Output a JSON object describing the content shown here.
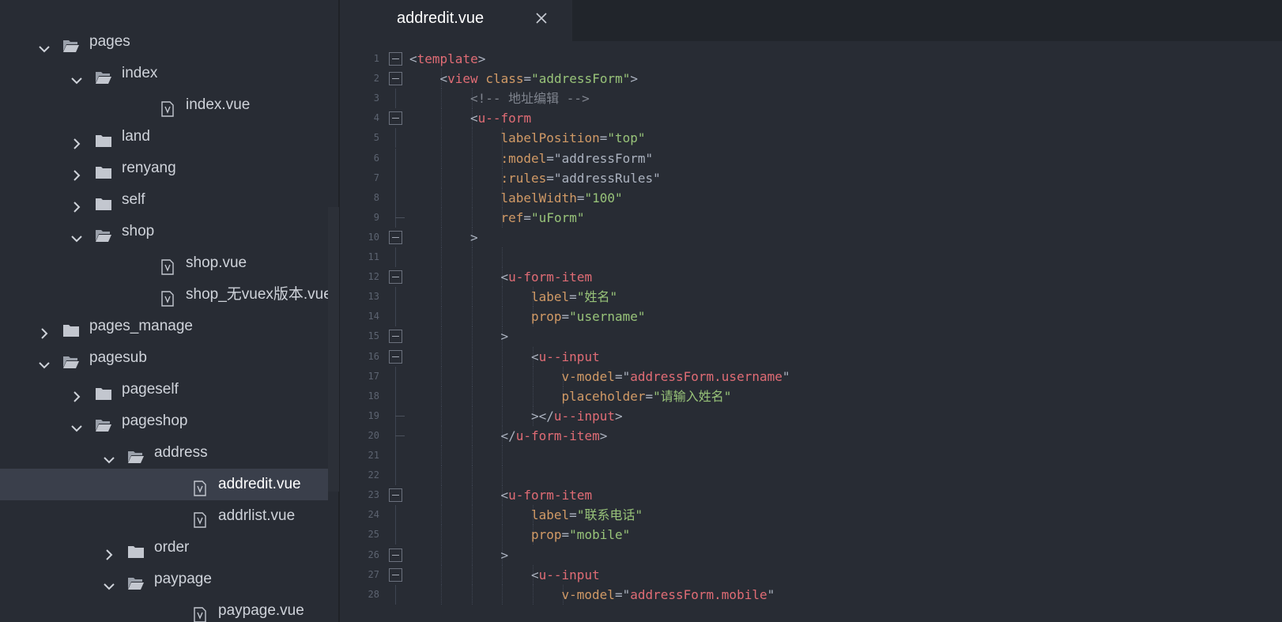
{
  "tab": {
    "label": "addredit.vue",
    "close_icon": "close-icon"
  },
  "tree": [
    {
      "label": "pages",
      "type": "folder",
      "open": true,
      "depth": 1
    },
    {
      "label": "index",
      "type": "folder",
      "open": true,
      "depth": 2
    },
    {
      "label": "index.vue",
      "type": "file",
      "depth": 3
    },
    {
      "label": "land",
      "type": "folder",
      "open": false,
      "depth": 2
    },
    {
      "label": "renyang",
      "type": "folder",
      "open": false,
      "depth": 2
    },
    {
      "label": "self",
      "type": "folder",
      "open": false,
      "depth": 2
    },
    {
      "label": "shop",
      "type": "folder",
      "open": true,
      "depth": 2
    },
    {
      "label": "shop.vue",
      "type": "file",
      "depth": 3
    },
    {
      "label": "shop_无vuex版本.vue",
      "type": "file",
      "depth": 3
    },
    {
      "label": "pages_manage",
      "type": "folder",
      "open": false,
      "depth": 1
    },
    {
      "label": "pagesub",
      "type": "folder",
      "open": true,
      "depth": 1
    },
    {
      "label": "pageself",
      "type": "folder",
      "open": false,
      "depth": 2
    },
    {
      "label": "pageshop",
      "type": "folder",
      "open": true,
      "depth": 2
    },
    {
      "label": "address",
      "type": "folder",
      "open": true,
      "depth": 3
    },
    {
      "label": "addredit.vue",
      "type": "file",
      "depth": 4,
      "selected": true
    },
    {
      "label": "addrlist.vue",
      "type": "file",
      "depth": 4
    },
    {
      "label": "order",
      "type": "folder",
      "open": false,
      "depth": 3
    },
    {
      "label": "paypage",
      "type": "folder",
      "open": true,
      "depth": 3
    },
    {
      "label": "paypage.vue",
      "type": "file",
      "depth": 4
    }
  ],
  "code": [
    {
      "n": "1",
      "indent": 0,
      "fold": "box",
      "tokens": [
        [
          "p",
          "<"
        ],
        [
          "tag",
          "template"
        ],
        [
          "p",
          ">"
        ]
      ]
    },
    {
      "n": "2",
      "indent": 1,
      "fold": "box",
      "tokens": [
        [
          "p",
          "<"
        ],
        [
          "tag",
          "view"
        ],
        [
          "p",
          " "
        ],
        [
          "attr",
          "class"
        ],
        [
          "p",
          "="
        ],
        [
          "str",
          "\"addressForm\""
        ],
        [
          "p",
          ">"
        ]
      ]
    },
    {
      "n": "3",
      "indent": 2,
      "fold": "line",
      "tokens": [
        [
          "cmt",
          "<!-- 地址编辑 -->"
        ]
      ]
    },
    {
      "n": "4",
      "indent": 2,
      "fold": "box",
      "tokens": [
        [
          "p",
          "<"
        ],
        [
          "tag",
          "u--form"
        ]
      ]
    },
    {
      "n": "5",
      "indent": 3,
      "fold": "line",
      "tokens": [
        [
          "attr",
          "labelPosition"
        ],
        [
          "p",
          "="
        ],
        [
          "str",
          "\"top\""
        ]
      ]
    },
    {
      "n": "6",
      "indent": 3,
      "fold": "line",
      "tokens": [
        [
          "attr",
          ":model"
        ],
        [
          "p",
          "=\"addressForm\""
        ]
      ]
    },
    {
      "n": "7",
      "indent": 3,
      "fold": "line",
      "tokens": [
        [
          "attr",
          ":rules"
        ],
        [
          "p",
          "=\"addressRules\""
        ]
      ]
    },
    {
      "n": "8",
      "indent": 3,
      "fold": "line",
      "tokens": [
        [
          "attr",
          "labelWidth"
        ],
        [
          "p",
          "="
        ],
        [
          "str",
          "\"100\""
        ]
      ]
    },
    {
      "n": "9",
      "indent": 3,
      "fold": "end",
      "tokens": [
        [
          "attr",
          "ref"
        ],
        [
          "p",
          "="
        ],
        [
          "str",
          "\"uForm\""
        ]
      ]
    },
    {
      "n": "10",
      "indent": 2,
      "fold": "box",
      "tokens": [
        [
          "p",
          ">"
        ]
      ]
    },
    {
      "n": "11",
      "indent": 3,
      "fold": "line",
      "tokens": []
    },
    {
      "n": "12",
      "indent": 3,
      "fold": "box",
      "tokens": [
        [
          "p",
          "<"
        ],
        [
          "tag",
          "u-form-item"
        ]
      ]
    },
    {
      "n": "13",
      "indent": 4,
      "fold": "line",
      "tokens": [
        [
          "attr",
          "label"
        ],
        [
          "p",
          "="
        ],
        [
          "str",
          "\"姓名\""
        ]
      ]
    },
    {
      "n": "14",
      "indent": 4,
      "fold": "line",
      "tokens": [
        [
          "attr",
          "prop"
        ],
        [
          "p",
          "="
        ],
        [
          "str",
          "\"username\""
        ]
      ]
    },
    {
      "n": "15",
      "indent": 3,
      "fold": "box",
      "tokens": [
        [
          "p",
          ">"
        ]
      ]
    },
    {
      "n": "16",
      "indent": 4,
      "fold": "box",
      "tokens": [
        [
          "p",
          "<"
        ],
        [
          "tag",
          "u--input"
        ]
      ]
    },
    {
      "n": "17",
      "indent": 5,
      "fold": "line",
      "tokens": [
        [
          "attr",
          "v-model"
        ],
        [
          "p",
          "=\""
        ],
        [
          "tag",
          "addressForm.username"
        ],
        [
          "p",
          "\""
        ]
      ]
    },
    {
      "n": "18",
      "indent": 5,
      "fold": "line",
      "tokens": [
        [
          "attr",
          "placeholder"
        ],
        [
          "p",
          "="
        ],
        [
          "str",
          "\"请输入姓名\""
        ]
      ]
    },
    {
      "n": "19",
      "indent": 4,
      "fold": "end",
      "tokens": [
        [
          "p",
          "></"
        ],
        [
          "tag",
          "u--input"
        ],
        [
          "p",
          ">"
        ]
      ]
    },
    {
      "n": "20",
      "indent": 3,
      "fold": "end",
      "tokens": [
        [
          "p",
          "</"
        ],
        [
          "tag",
          "u-form-item"
        ],
        [
          "p",
          ">"
        ]
      ]
    },
    {
      "n": "21",
      "indent": 3,
      "fold": "line",
      "tokens": []
    },
    {
      "n": "22",
      "indent": 3,
      "fold": "line",
      "tokens": []
    },
    {
      "n": "23",
      "indent": 3,
      "fold": "box",
      "tokens": [
        [
          "p",
          "<"
        ],
        [
          "tag",
          "u-form-item"
        ]
      ]
    },
    {
      "n": "24",
      "indent": 4,
      "fold": "line",
      "tokens": [
        [
          "attr",
          "label"
        ],
        [
          "p",
          "="
        ],
        [
          "str",
          "\"联系电话\""
        ]
      ]
    },
    {
      "n": "25",
      "indent": 4,
      "fold": "line",
      "tokens": [
        [
          "attr",
          "prop"
        ],
        [
          "p",
          "="
        ],
        [
          "str",
          "\"mobile\""
        ]
      ]
    },
    {
      "n": "26",
      "indent": 3,
      "fold": "box",
      "tokens": [
        [
          "p",
          ">"
        ]
      ]
    },
    {
      "n": "27",
      "indent": 4,
      "fold": "box",
      "tokens": [
        [
          "p",
          "<"
        ],
        [
          "tag",
          "u--input"
        ]
      ]
    },
    {
      "n": "28",
      "indent": 5,
      "fold": "line",
      "tokens": [
        [
          "attr",
          "v-model"
        ],
        [
          "p",
          "=\""
        ],
        [
          "tag",
          "addressForm.mobile"
        ],
        [
          "p",
          "\""
        ]
      ]
    }
  ],
  "colors": {
    "background": "#282c34",
    "tag": "#e06c75",
    "attribute": "#d19a66",
    "string": "#98c379",
    "comment": "#7f848e"
  }
}
